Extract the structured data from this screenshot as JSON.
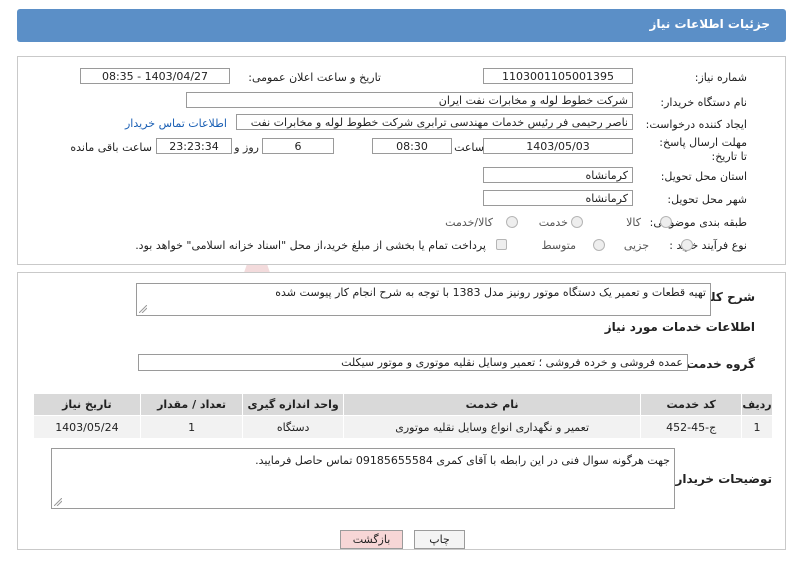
{
  "header": {
    "title": "جزئیات اطلاعات نیاز"
  },
  "form": {
    "need_number_label": "شماره نیاز:",
    "need_number": "1103001105001395",
    "announce_label": "تاریخ و ساعت اعلان عمومی:",
    "announce_value": "1403/04/27 - 08:35",
    "buyer_label": "نام دستگاه خریدار:",
    "buyer_value": "شرکت خطوط لوله و مخابرات نفت ایران",
    "creator_label": "ایجاد کننده درخواست:",
    "creator_value": "ناصر رحیمی فر رئیس خدمات مهندسی ترابری شرکت خطوط لوله و مخابرات نفت",
    "contact_link": "اطلاعات تماس خریدار",
    "deadline_label": "مهلت ارسال پاسخ: تا تاریخ:",
    "deadline_date": "1403/05/03",
    "time_label": "ساعت",
    "deadline_time": "08:30",
    "days_value": "6",
    "days_label": "روز و",
    "remaining_time": "23:23:34",
    "remaining_label": "ساعت باقی مانده",
    "province_label": "استان محل تحویل:",
    "province_value": "کرمانشاه",
    "city_label": "شهر محل تحویل:",
    "city_value": "کرمانشاه",
    "category_label": "طبقه بندی موضوعی:",
    "category_options": [
      "کالا",
      "خدمت",
      "کالا/خدمت"
    ],
    "process_label": "نوع فرآیند خرید :",
    "process_options": [
      "جزیی",
      "متوسط"
    ],
    "payment_note": "پرداخت تمام یا بخشی از مبلغ خرید،از محل \"اسناد خزانه اسلامی\" خواهد بود."
  },
  "summary": {
    "label": "شرح کلی نیاز:",
    "text": "تهیه قطعات و تعمیر یک دستگاه موتور رونیز مدل 1383 با توجه به شرح انجام کار پیوست شده"
  },
  "services": {
    "section_title": "اطلاعات خدمات مورد نیاز",
    "group_label": "گروه خدمت:",
    "group_value": "عمده فروشی و خرده فروشی ؛ تعمیر وسایل نقلیه موتوری و موتور سیکلت",
    "columns": [
      "ردیف",
      "کد خدمت",
      "نام خدمت",
      "واحد اندازه گیری",
      "تعداد / مقدار",
      "تاریخ نیاز"
    ],
    "rows": [
      [
        "1",
        "ج-45-452",
        "تعمیر و نگهداری انواع وسایل نقلیه موتوری",
        "دستگاه",
        "1",
        "1403/05/24"
      ]
    ]
  },
  "buyer_notes": {
    "label": "توضیحات خریدار:",
    "text": "جهت هرگونه سوال فنی در این رابطه با آقای کمری 09185655584 تماس حاصل فرمایید."
  },
  "buttons": {
    "print": "چاپ",
    "back": "بازگشت"
  },
  "watermark": {
    "text": "AriaTender.neT"
  },
  "colors": {
    "header": "#5b8fc7",
    "link": "#1a5fb4",
    "back_button": "#f7d6d6",
    "table_header": "#d9d9d9"
  }
}
